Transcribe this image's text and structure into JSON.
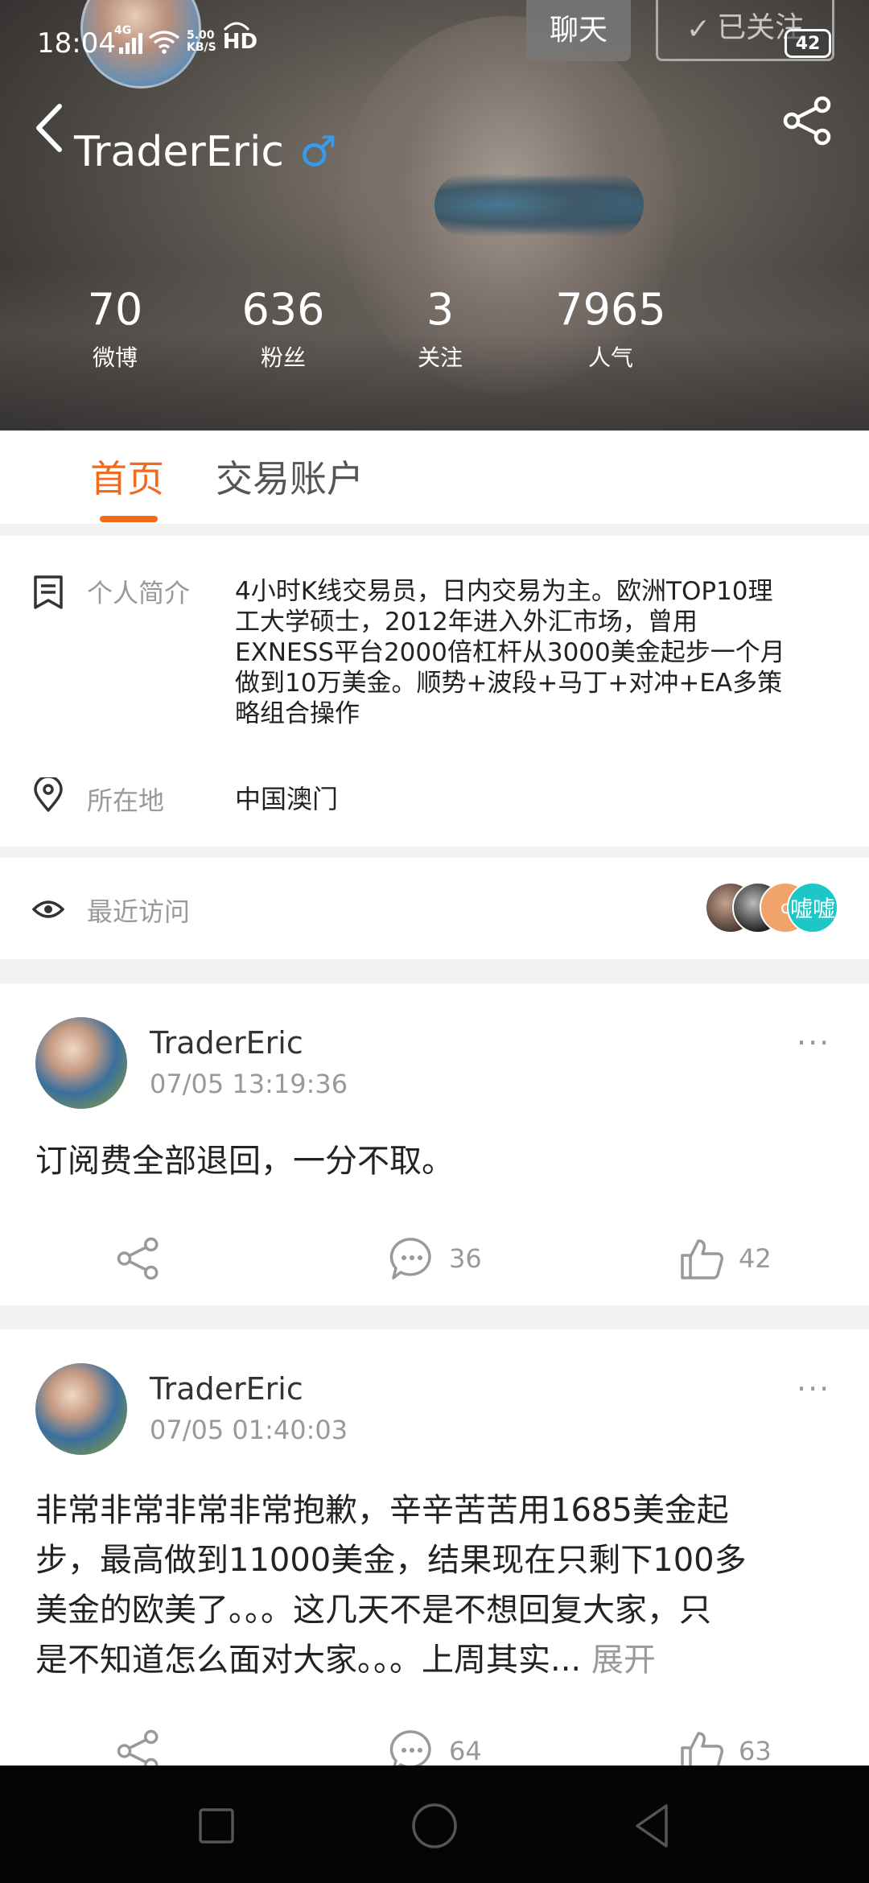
{
  "status_bar": {
    "time": "18:04",
    "network": "4G",
    "speed_value": "5.00",
    "speed_unit": "KB/S",
    "hd": "HD"
  },
  "header": {
    "chat_button": "聊天",
    "follow_button": "已关注",
    "notification_count": "42",
    "username": "TraderEric",
    "gender_symbol": "♂",
    "stats": [
      {
        "value": "70",
        "label": "微博"
      },
      {
        "value": "636",
        "label": "粉丝"
      },
      {
        "value": "3",
        "label": "关注"
      },
      {
        "value": "7965",
        "label": "人气"
      }
    ]
  },
  "tabs": [
    {
      "label": "首页",
      "active": true
    },
    {
      "label": "交易账户",
      "active": false
    }
  ],
  "profile": {
    "bio_label": "个人简介",
    "bio_lines": [
      "4小时K线交易员，日内交易为主。欧洲TOP10理",
      "工大学硕士，2012年进入外汇市场，曾用",
      "EXNESS平台2000倍杠杆从3000美金起步一个月",
      "做到10万美金。顺势+波段+马丁+对冲+EA多策",
      "略组合操作"
    ],
    "location_label": "所在地",
    "location_value": "中国澳门"
  },
  "recent_visits": {
    "label": "最近访问",
    "visitor_initial": "c",
    "visitor_name": "嘘嘘"
  },
  "posts": [
    {
      "author": "TraderEric",
      "time": "07/05 13:19:36",
      "more": "···",
      "text_lines": [
        "订阅费全部退回，一分不取。"
      ],
      "comments": "36",
      "likes": "42"
    },
    {
      "author": "TraderEric",
      "time": "07/05 01:40:03",
      "more": "···",
      "text_lines": [
        "非常非常非常非常抱歉，辛辛苦苦用1685美金起",
        "步，最高做到11000美金，结果现在只剩下100多",
        "美金的欧美了。。。这几天不是不想回复大家，只",
        "是不知道怎么面对大家。。。上周其实..."
      ],
      "expand_label": "展开",
      "comments": "64",
      "likes": "63"
    }
  ],
  "colors": {
    "accent": "#f26b1d",
    "gender": "#3a9aea",
    "muted_text": "#999999"
  }
}
